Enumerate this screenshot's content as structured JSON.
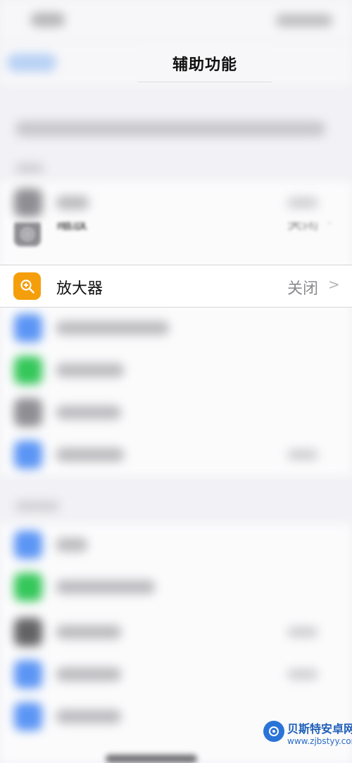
{
  "nav": {
    "title": "辅助功能"
  },
  "settings": {
    "zoom": {
      "label": "缩放",
      "value": "关闭"
    },
    "magnifier": {
      "label": "放大器",
      "value": "关闭"
    }
  },
  "watermark": {
    "name": "贝斯特安卓网",
    "url": "www.zjbstyy.com"
  }
}
